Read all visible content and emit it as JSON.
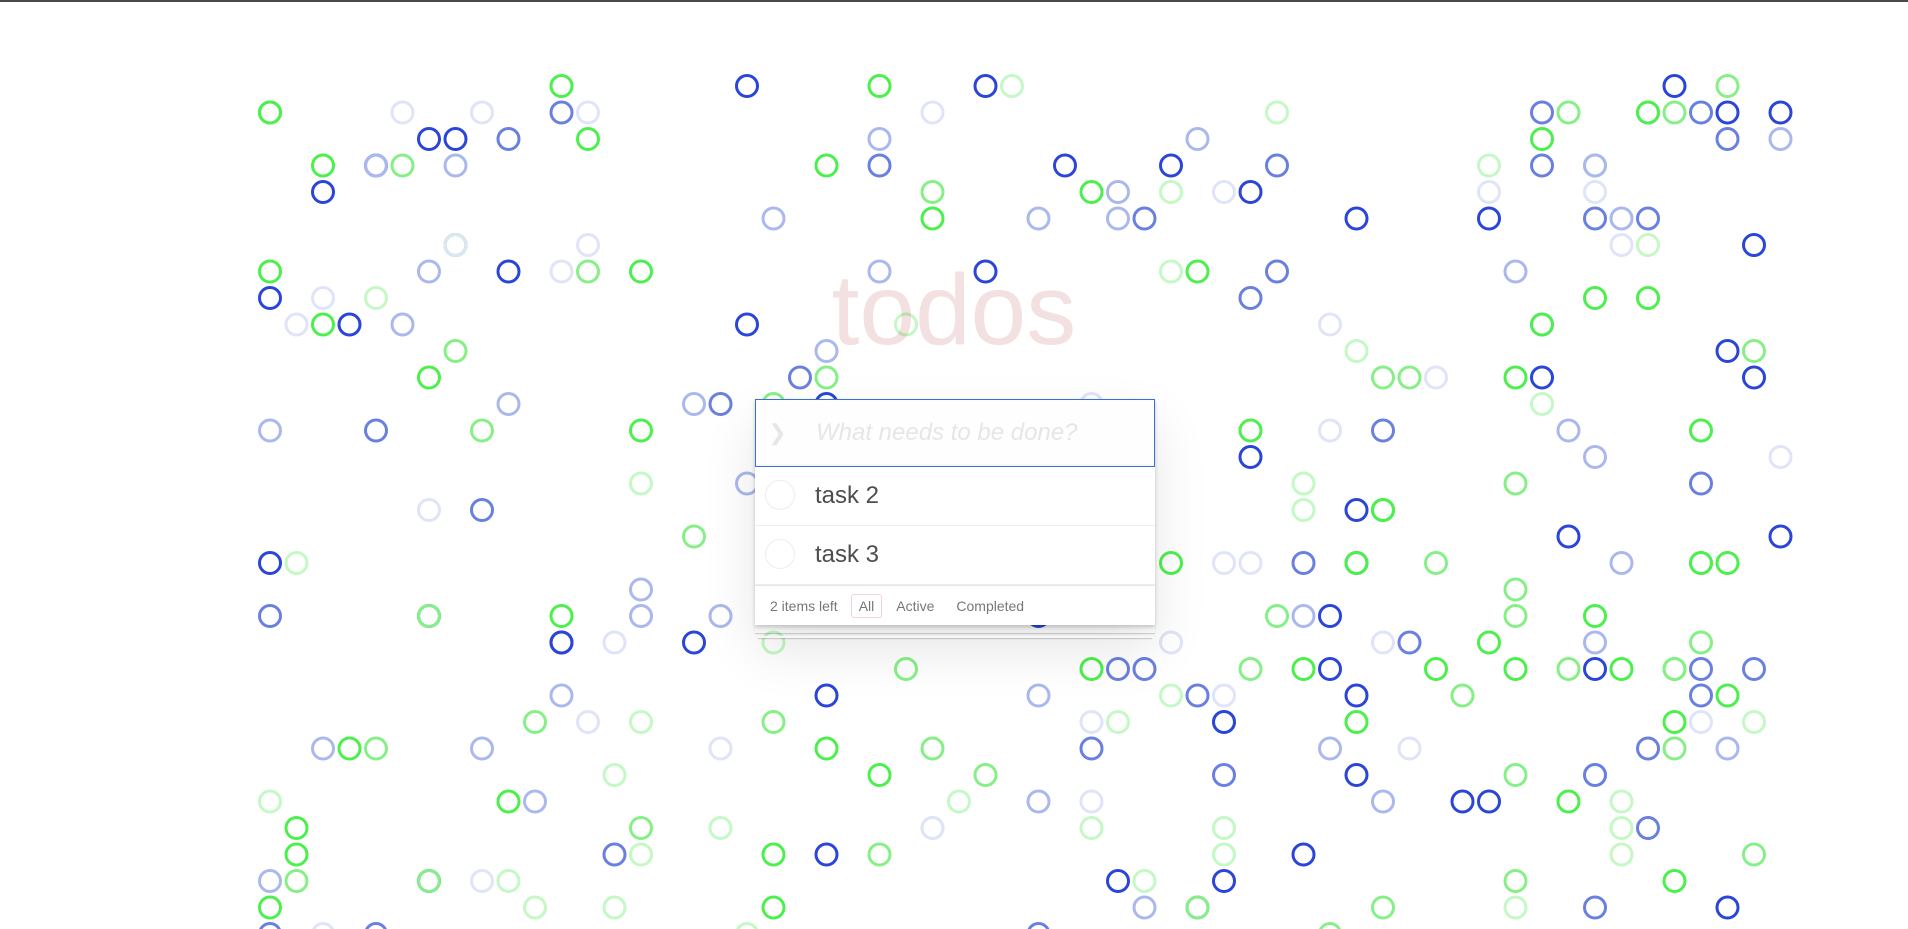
{
  "app": {
    "title": "todos",
    "input": {
      "placeholder": "What needs to be done?",
      "value": ""
    },
    "toggle_all_icon": "chevron-down-icon",
    "todos": [
      {
        "label": "task 2",
        "completed": false
      },
      {
        "label": "task 3",
        "completed": false
      }
    ],
    "footer": {
      "items_left": "2 items left",
      "filters": [
        {
          "label": "All",
          "selected": true
        },
        {
          "label": "Active",
          "selected": false
        },
        {
          "label": "Completed",
          "selected": false
        }
      ]
    }
  },
  "colors": {
    "dark_blue": "#2a45d8",
    "mid_blue": "#6a80e0",
    "light_blue": "#aab8ee",
    "pale_blue": "#dfe4f8",
    "bright_green": "#4cf04c",
    "mid_green": "#86f086",
    "light_green": "#c4f8c4"
  }
}
